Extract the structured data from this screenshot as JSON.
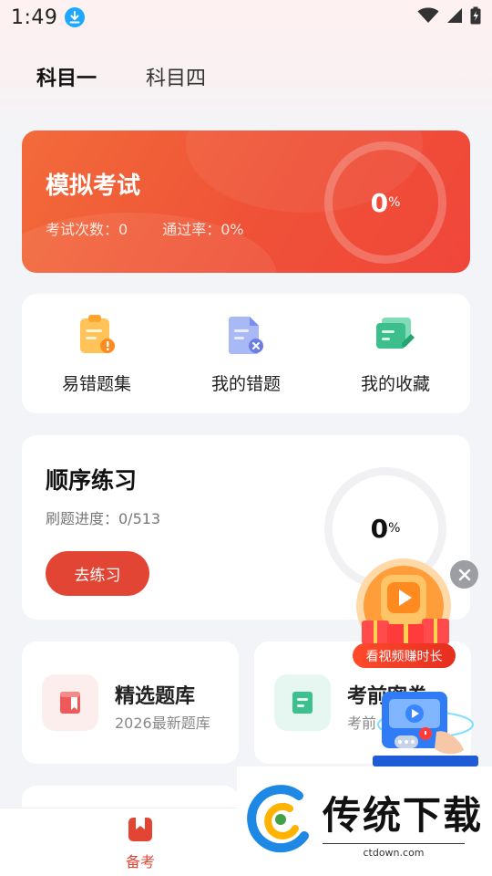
{
  "status_bar": {
    "time": "1:49"
  },
  "tabs": [
    {
      "label": "科目一",
      "active": true
    },
    {
      "label": "科目四",
      "active": false
    }
  ],
  "exam_card": {
    "title": "模拟考试",
    "count_text": "考试次数：0",
    "pass_rate_text": "通过率：0%",
    "percent_value": "0",
    "percent_unit": "%",
    "progress": 0,
    "colors": {
      "start": "#f26b3a",
      "end": "#f0463a"
    }
  },
  "quick_actions": [
    {
      "label": "易错题集",
      "icon": "clipboard-warning-icon"
    },
    {
      "label": "我的错题",
      "icon": "document-error-icon"
    },
    {
      "label": "我的收藏",
      "icon": "folder-edit-icon"
    }
  ],
  "sequential": {
    "title": "顺序练习",
    "progress_text": "刷题进度：0/513",
    "button_label": "去练习",
    "percent_value": "0",
    "percent_unit": "%",
    "progress": 0
  },
  "banks": [
    {
      "title": "精选题库",
      "subtitle": "2026最新题库",
      "icon": "bookmark-book-icon",
      "icon_bg": "#fdeeee"
    },
    {
      "title": "考前密卷",
      "subtitle": "考前",
      "icon": "document-green-icon",
      "icon_bg": "#e6f7f1"
    }
  ],
  "float_ad": {
    "label": "看视频赚时长"
  },
  "bottom_nav": {
    "items": [
      {
        "label": "备考",
        "active": true,
        "icon": "book-bookmark-icon"
      }
    ]
  },
  "watermark": {
    "title": "传统下载",
    "url": "ctdown.com"
  },
  "accent_color": "#e34535"
}
